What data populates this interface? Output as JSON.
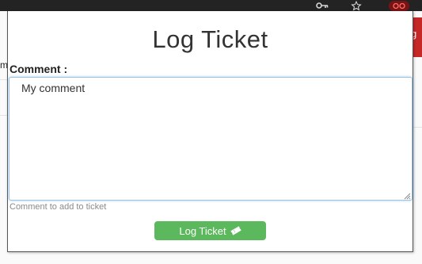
{
  "background": {
    "letter_left": "m",
    "badge_letter": "g"
  },
  "popup": {
    "title": "Log Ticket",
    "comment_label": "Comment :",
    "comment_value": "My comment",
    "helper_text": "Comment to add to ticket",
    "submit_label": "Log Ticket"
  },
  "icons": {
    "toolbar": [
      "key-icon",
      "star-icon",
      "profile-icon"
    ],
    "submit": "ticket-icon"
  },
  "colors": {
    "browser_bar": "#232323",
    "submit_button": "#5cb85c",
    "focus_border": "#9fc3de",
    "badge": "#c62828"
  }
}
